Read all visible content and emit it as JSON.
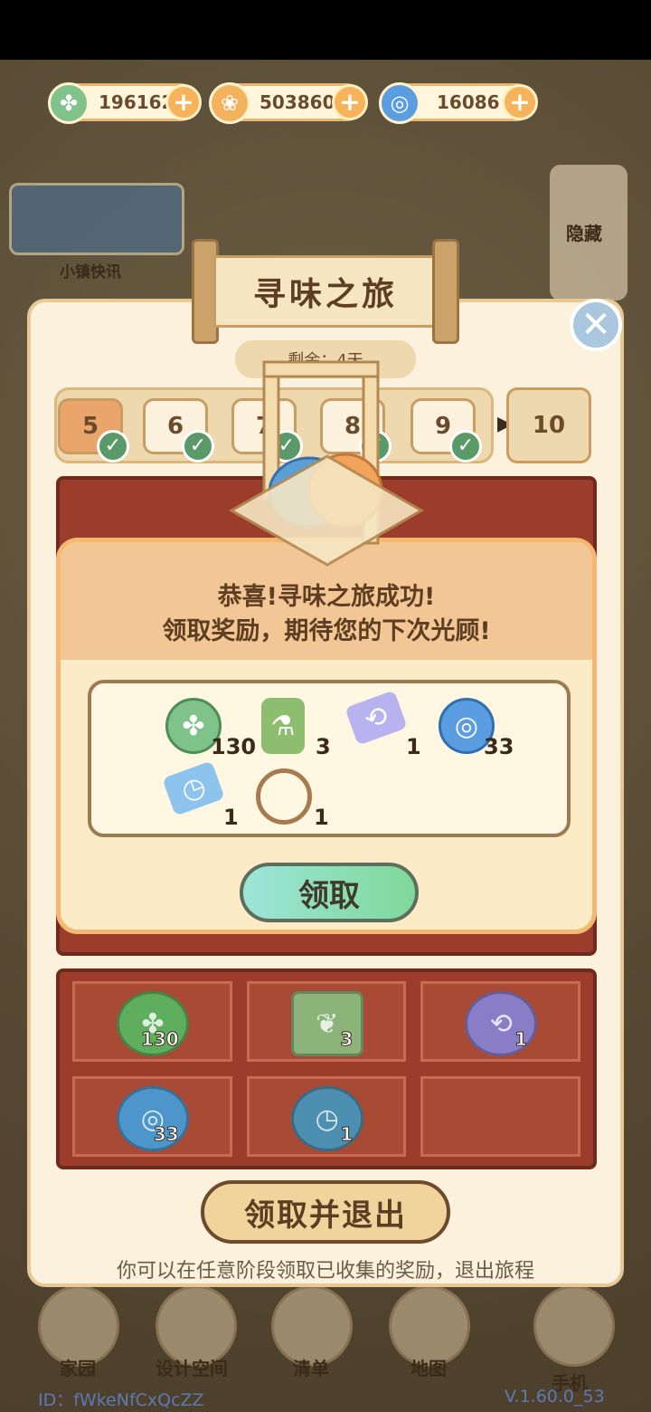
{
  "currencies": [
    {
      "icon": "clover-coin-icon",
      "value": "196162",
      "color": "#7fc28a"
    },
    {
      "icon": "gold-flower-coin-icon",
      "value": "503860",
      "color": "#f4b25c"
    },
    {
      "icon": "blue-swirl-coin-icon",
      "value": "16086",
      "color": "#5a9de0"
    }
  ],
  "banner": {
    "label": "小镇快讯"
  },
  "hide": {
    "label": "隐藏"
  },
  "journey": {
    "title": "寻味之旅",
    "remaining": "剩余：4天",
    "steps": [
      "5",
      "6",
      "7",
      "8",
      "9"
    ],
    "next_step": "10"
  },
  "grid_items": [
    {
      "icon": "clover-mooncake-icon",
      "count": "130",
      "color": "#5fae5e"
    },
    {
      "icon": "leaf-cake-icon",
      "count": "3",
      "color": "#8bb37a"
    },
    {
      "icon": "swap-mooncake-icon",
      "count": "1",
      "color": "#8a7dc8"
    },
    {
      "icon": "swirl-mooncake-icon",
      "count": "33",
      "color": "#4d96cc"
    },
    {
      "icon": "clock-mooncake-icon",
      "count": "1",
      "color": "#4d8fb0"
    }
  ],
  "popup": {
    "line1": "恭喜!寻味之旅成功!",
    "line2": "领取奖励，期待您的下次光顾!",
    "claim": "领取",
    "rewards": [
      {
        "icon": "clover-coin-icon",
        "count": "130",
        "color": "#7fc28a"
      },
      {
        "icon": "potion-bottle-icon",
        "count": "3",
        "color": "#8dbd6f"
      },
      {
        "icon": "swap-ticket-icon",
        "count": "1",
        "color": "#b8b2ef"
      },
      {
        "icon": "blue-swirl-coin-icon",
        "count": "33",
        "color": "#5a9de0"
      },
      {
        "icon": "clock-ticket-icon",
        "count": "1",
        "color": "#8cc4ee"
      },
      {
        "icon": "floral-wreath-icon",
        "count": "1",
        "color": "#a57b4f"
      }
    ]
  },
  "exit": {
    "label": "领取并退出",
    "hint": "你可以在任意阶段领取已收集的奖励，退出旅程"
  },
  "nav": [
    "家园",
    "设计空间",
    "清单",
    "地图",
    "手机"
  ],
  "footer": {
    "id": "ID：fWkeNfCxQcZZ",
    "version": "V.1.60.0_53"
  }
}
